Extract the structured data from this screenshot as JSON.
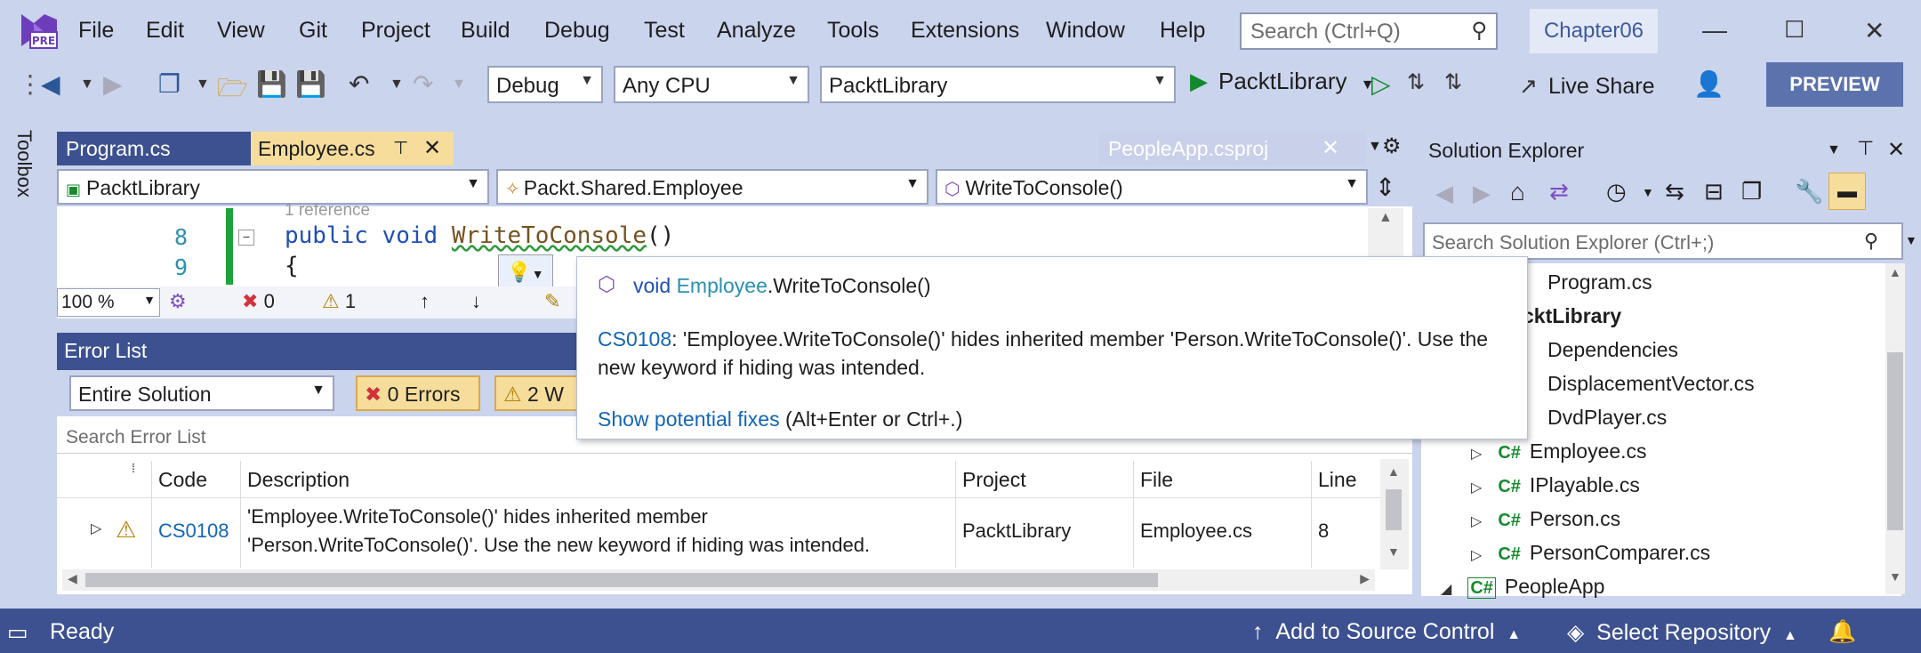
{
  "menu": {
    "items": [
      "File",
      "Edit",
      "View",
      "Git",
      "Project",
      "Build",
      "Debug",
      "Test",
      "Analyze",
      "Tools",
      "Extensions",
      "Window",
      "Help"
    ],
    "search_placeholder": "Search (Ctrl+Q)",
    "solution_name": "Chapter06",
    "logo_badge": "PRE"
  },
  "toolbar": {
    "config": "Debug",
    "platform": "Any CPU",
    "startup_project": "PacktLibrary",
    "run_label": "PacktLibrary",
    "live_share": "Live Share",
    "preview": "PREVIEW"
  },
  "toolbox": {
    "label": "Toolbox"
  },
  "tabs": {
    "program": "Program.cs",
    "employee": "Employee.cs",
    "people_proj": "PeopleApp.csproj"
  },
  "navbar": {
    "project": "PacktLibrary",
    "type": "Packt.Shared.Employee",
    "member": "WriteToConsole()"
  },
  "code": {
    "ref_hint": "1 reference",
    "line8_no": "8",
    "line9_no": "9",
    "line8_kw1": "public",
    "line8_kw2": "void",
    "line8_name": "WriteToConsole",
    "line8_parens": "()",
    "line9": "{"
  },
  "editor_status": {
    "zoom": "100 %",
    "errors": "0",
    "warnings": "1"
  },
  "tooltip": {
    "sig_kw": "void",
    "sig_type": "Employee",
    "sig_rest": ".WriteToConsole()",
    "error_code": "CS0108",
    "msg_line1": ": 'Employee.WriteToConsole()' hides inherited member 'Person.WriteToConsole()'. Use the",
    "msg_line2": "new keyword if hiding was intended.",
    "fix_link": "Show potential fixes",
    "fix_hint": " (Alt+Enter or Ctrl+.)"
  },
  "error_list": {
    "title": "Error List",
    "scope": "Entire Solution",
    "errors_btn": "0 Errors",
    "warnings_btn": "2 W",
    "search_placeholder": "Search Error List",
    "columns": [
      "Code",
      "Description",
      "Project",
      "File",
      "Line"
    ],
    "rows": [
      {
        "code": "CS0108",
        "desc1": "'Employee.WriteToConsole()' hides inherited member",
        "desc2": "'Person.WriteToConsole()'. Use the new keyword if hiding was intended.",
        "project": "PacktLibrary",
        "file": "Employee.cs",
        "line": "8"
      }
    ]
  },
  "solution_explorer": {
    "title": "Solution Explorer",
    "search_placeholder": "Search Solution Explorer (Ctrl+;)",
    "items": [
      {
        "label": "Program.cs"
      },
      {
        "label": "cktLibrary"
      },
      {
        "label": "Dependencies"
      },
      {
        "label": "DisplacementVector.cs"
      },
      {
        "label": "DvdPlayer.cs"
      },
      {
        "label": "Employee.cs"
      },
      {
        "label": "IPlayable.cs"
      },
      {
        "label": "Person.cs"
      },
      {
        "label": "PersonComparer.cs"
      },
      {
        "label": "PeopleApp"
      }
    ],
    "cs_badge": "C#"
  },
  "statusbar": {
    "ready": "Ready",
    "source_control": "Add to Source Control",
    "repository": "Select Repository"
  },
  "colors": {
    "chrome": "#cbd4ed",
    "accent_dark": "#3d5190",
    "active_tab": "#f6dd9b",
    "preview": "#5b72ad"
  }
}
